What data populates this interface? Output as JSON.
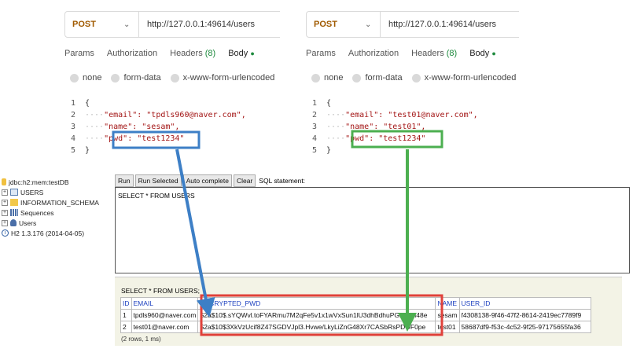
{
  "left_request": {
    "method": "POST",
    "url": "http://127.0.0.1:49614/users",
    "tabs": [
      "Params",
      "Authorization",
      "Headers",
      "Body"
    ],
    "headers_count": "(8)",
    "body_options": [
      "none",
      "form-data",
      "x-www-form-urlencoded"
    ],
    "line_numbers": [
      "1",
      "2",
      "3",
      "4",
      "5"
    ],
    "lines": [
      "{",
      "\"email\": \"tpdls960@naver.com\",",
      "\"name\": \"sesam\",",
      "\"pwd\": \"test1234\"",
      "}"
    ]
  },
  "right_request": {
    "method": "POST",
    "url": "http://127.0.0.1:49614/users",
    "tabs": [
      "Params",
      "Authorization",
      "Headers",
      "Body"
    ],
    "headers_count": "(8)",
    "body_options": [
      "none",
      "form-data",
      "x-www-form-urlencoded"
    ],
    "line_numbers": [
      "1",
      "2",
      "3",
      "4",
      "5"
    ],
    "lines": [
      "{",
      "\"email\": \"test01@naver.com\",",
      "\"name\": \"test01\",",
      "\"pwd\": \"test1234\"",
      "}"
    ]
  },
  "h2": {
    "tree": [
      "jdbc:h2:mem:testDB",
      "USERS",
      "INFORMATION_SCHEMA",
      "Sequences",
      "Users",
      "H2 1.3.176 (2014-04-05)"
    ],
    "buttons": [
      "Run",
      "Run Selected",
      "Auto complete",
      "Clear"
    ],
    "sql_label": "SQL statement:",
    "sql": "SELECT * FROM USERS",
    "result_query": "SELECT * FROM USERS;",
    "columns": [
      "ID",
      "EMAIL",
      "ENCRYPTED_PWD",
      "NAME",
      "USER_ID"
    ],
    "rows": [
      [
        "1",
        "tpdls960@naver.com",
        "$2a$10$.sYQWvl.toFYARmu7M2qFe5v1x1wVxSun1lU3dhBdhuPG2g7M48e",
        "sesam",
        "f4308138-9f46-47f2-8614-2419ec7789f9"
      ],
      [
        "2",
        "test01@naver.com",
        "$2a$10$3XkVzUcif8Z47SGDVJpl3.Hvwe/LkyLiZnG48Xr7CASbRsPDOF0pe",
        "test01",
        "58687df9-f53c-4c52-9f25-97175655fa36"
      ]
    ],
    "row_count": "(2 rows, 1 ms)"
  },
  "colors": {
    "blue_highlight": "#3d7fc6",
    "green_highlight": "#4caf50",
    "red_highlight": "#e0413a"
  }
}
